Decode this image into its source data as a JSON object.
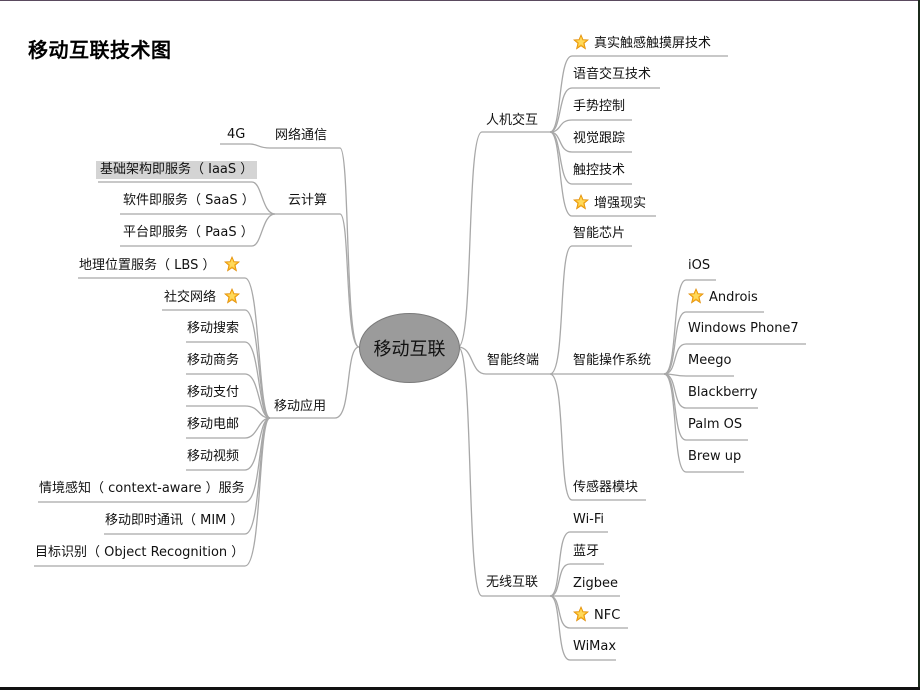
{
  "title": "移动互联技术图",
  "center": "移动互联",
  "colors": {
    "line": "#a8a8a8",
    "center_fill": "#9b9b9b",
    "highlight": "#d4d4d4",
    "star": "#f5a623"
  },
  "left_branches": [
    {
      "label": "网络通信",
      "children": [
        {
          "label": "4G",
          "star": false,
          "highlight": false
        }
      ]
    },
    {
      "label": "云计算",
      "children": [
        {
          "label": "基础架构即服务（ IaaS ）",
          "star": false,
          "highlight": true
        },
        {
          "label": "软件即服务（ SaaS ）",
          "star": false,
          "highlight": false
        },
        {
          "label": "平台即服务（ PaaS ）",
          "star": false,
          "highlight": false
        }
      ]
    },
    {
      "label": "移动应用",
      "children": [
        {
          "label": "地理位置服务（ LBS ）",
          "star": true,
          "highlight": false
        },
        {
          "label": "社交网络",
          "star": true,
          "highlight": false
        },
        {
          "label": "移动搜索",
          "star": false,
          "highlight": false
        },
        {
          "label": "移动商务",
          "star": false,
          "highlight": false
        },
        {
          "label": "移动支付",
          "star": false,
          "highlight": false
        },
        {
          "label": "移动电邮",
          "star": false,
          "highlight": false
        },
        {
          "label": "移动视频",
          "star": false,
          "highlight": false
        },
        {
          "label": "情境感知（ context-aware ）服务",
          "star": false,
          "highlight": false
        },
        {
          "label": "移动即时通讯（ MIM ）",
          "star": false,
          "highlight": false
        },
        {
          "label": "目标识别（ Object Recognition ）",
          "star": false,
          "highlight": false
        }
      ]
    }
  ],
  "right_branches": [
    {
      "label": "人机交互",
      "children": [
        {
          "label": "真实触感触摸屏技术",
          "star": true
        },
        {
          "label": "语音交互技术",
          "star": false
        },
        {
          "label": "手势控制",
          "star": false
        },
        {
          "label": "视觉跟踪",
          "star": false
        },
        {
          "label": "触控技术",
          "star": false
        },
        {
          "label": "增强现实",
          "star": true
        }
      ]
    },
    {
      "label": "智能终端",
      "children": [
        {
          "label": "智能芯片",
          "star": false
        },
        {
          "label": "智能操作系统",
          "star": false,
          "children": [
            {
              "label": "iOS",
              "star": false
            },
            {
              "label": "Androis",
              "star": true
            },
            {
              "label": "Windows Phone7",
              "star": false
            },
            {
              "label": "Meego",
              "star": false
            },
            {
              "label": "Blackberry",
              "star": false
            },
            {
              "label": "Palm OS",
              "star": false
            },
            {
              "label": "Brew up",
              "star": false
            }
          ]
        },
        {
          "label": "传感器模块",
          "star": false
        }
      ]
    },
    {
      "label": "无线互联",
      "children": [
        {
          "label": "Wi-Fi",
          "star": false
        },
        {
          "label": "蓝牙",
          "star": false
        },
        {
          "label": "Zigbee",
          "star": false
        },
        {
          "label": "NFC",
          "star": true
        },
        {
          "label": "WiMax",
          "star": false
        }
      ]
    }
  ]
}
